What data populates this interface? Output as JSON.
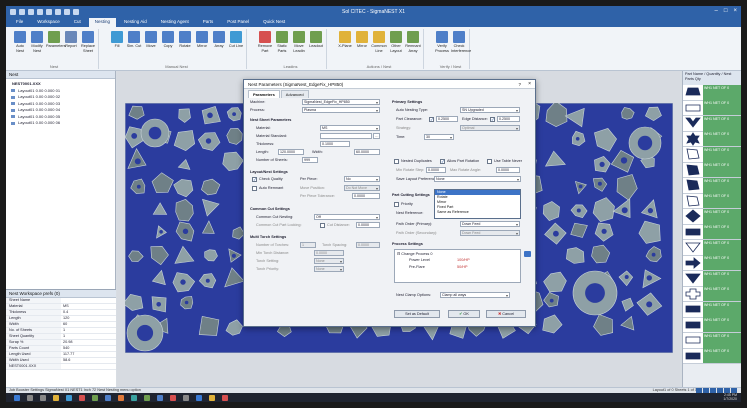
{
  "window": {
    "title": "Sol CITEC - SigmaNEST X1",
    "min_glyph": "–",
    "max_glyph": "□",
    "close_glyph": "×"
  },
  "ribbon": {
    "tabs": [
      "File",
      "Workspace",
      "Cut",
      "Nesting",
      "Nesting Aid",
      "Nesting Agent",
      "Parts",
      "Post Panel",
      "Quick Nest"
    ],
    "active_tab": 3,
    "buttons": [
      {
        "label": "Auto Nest",
        "color": "#4f7fc8"
      },
      {
        "label": "Modify Nest",
        "color": "#4f7fc8"
      },
      {
        "label": "Parameters",
        "color": "#6f9e4f"
      },
      {
        "label": "Report",
        "color": "#6a88b9"
      },
      {
        "label": "Replace Sheet",
        "color": "#4f7fc8"
      },
      {
        "label": "Fill",
        "color": "#3f9ad4"
      },
      {
        "label": "Sim. Cut",
        "color": "#4f7fc8"
      },
      {
        "label": "Move",
        "color": "#4f7fc8"
      },
      {
        "label": "Copy",
        "color": "#4f7fc8"
      },
      {
        "label": "Rotate",
        "color": "#4f7fc8"
      },
      {
        "label": "Mirror",
        "color": "#4f7fc8"
      },
      {
        "label": "Array",
        "color": "#4f7fc8"
      },
      {
        "label": "Cut Line",
        "color": "#3f9ad4"
      },
      {
        "label": "Remove Part",
        "color": "#d65050"
      },
      {
        "label": "Static Parts",
        "color": "#6f9e4f"
      },
      {
        "label": "Move Leadin",
        "color": "#6f9e4f"
      },
      {
        "label": "Leadout",
        "color": "#6f9e4f"
      },
      {
        "label": "X-Plane",
        "color": "#e0b23a"
      },
      {
        "label": "Mirror",
        "color": "#e0b23a"
      },
      {
        "label": "Common Line",
        "color": "#e0b23a"
      },
      {
        "label": "Other Layout",
        "color": "#6f9e4f"
      },
      {
        "label": "Remnant Array",
        "color": "#6f9e4f"
      },
      {
        "label": "Verify Process",
        "color": "#4f7fc8"
      },
      {
        "label": "Check Interference",
        "color": "#4f7fc8"
      }
    ],
    "groups": [
      "Nest",
      "Manual Nest",
      "Leadins",
      "Actions / Nest",
      "Verify / Nest"
    ]
  },
  "left_panel": {
    "title": "Nest",
    "tree": [
      {
        "label": "NEST0001.XXX",
        "root": true
      },
      {
        "label": "Layout01 0.00 0.000 01"
      },
      {
        "label": "Layout01 0.00 0.000 02"
      },
      {
        "label": "Layout01 0.00 0.000 03"
      },
      {
        "label": "Layout01 0.00 0.000 04"
      },
      {
        "label": "Layout01 0.00 0.000 05"
      },
      {
        "label": "Layout01 0.00 0.000 06"
      }
    ],
    "props_title": "Nest Workspace prefs (0)",
    "props": [
      {
        "k": "Sheet Name",
        "v": ""
      },
      {
        "k": "Material",
        "v": "MS"
      },
      {
        "k": "Thickness",
        "v": "0.4"
      },
      {
        "k": "Length",
        "v": "120"
      },
      {
        "k": "Width",
        "v": "60"
      },
      {
        "k": "No. of Sheets",
        "v": "1"
      },
      {
        "k": "Sheet Quantity",
        "v": "1"
      },
      {
        "k": "Scrap %",
        "v": "20.98"
      },
      {
        "k": "Parts Count",
        "v": "540"
      },
      {
        "k": "Length Used",
        "v": "117.77"
      },
      {
        "k": "Width Used",
        "v": "58.6"
      },
      {
        "k": "NEST0001.XXX",
        "v": ""
      }
    ]
  },
  "right_panel": {
    "header": "Part Name / Quantity / Nest Parts Qty",
    "parts": [
      {
        "label": "WH1 NET OF 0",
        "shape": "trap"
      },
      {
        "label": "WH1 NET OF 0",
        "shape": "rect"
      },
      {
        "label": "WH1 NET OF 0",
        "shape": "vee"
      },
      {
        "label": "WH1 NET OF 0",
        "shape": "gear"
      },
      {
        "label": "WH1 NET OF 0",
        "shape": "poly"
      },
      {
        "label": "WH1 NET OF 0",
        "shape": "poly"
      },
      {
        "label": "WH1 NET OF 0",
        "shape": "poly"
      },
      {
        "label": "WH1 NET OF 0",
        "shape": "poly"
      },
      {
        "label": "WH1 NET OF 0",
        "shape": "diamond"
      },
      {
        "label": "WH1 NET OF 0",
        "shape": "rect"
      },
      {
        "label": "WH1 NET OF 0",
        "shape": "tri"
      },
      {
        "label": "WH1 NET OF 0",
        "shape": "arrow"
      },
      {
        "label": "WH1 NET OF 0",
        "shape": "tri"
      },
      {
        "label": "WH1 NET OF 0",
        "shape": "plus"
      },
      {
        "label": "WH1 NET OF 0",
        "shape": "rect"
      },
      {
        "label": "WH1 NET OF 0",
        "shape": "rect"
      },
      {
        "label": "WH1 NET OF 0",
        "shape": "rect"
      },
      {
        "label": "WH1 NET OF 0",
        "shape": "rect"
      }
    ]
  },
  "status": {
    "text": "Job Booster Settings    SigmaNest X1 NEST1    Inch    72    Nest Nesting menu option",
    "right_text": "Layout1 of 0 Sheets 1 of 1"
  },
  "clock": {
    "time": "2:45 PM",
    "date": "1/7/2020"
  },
  "dialog": {
    "title": "Nest Parameters (SigmaNest_EdgeFix_HP850)",
    "help": "?",
    "close": "×",
    "tabs": [
      "Parameters",
      "Advanced"
    ],
    "machine_label": "Machine:",
    "machine_value": "SigmaNest_EdgeFix_HP850",
    "process_label": "Process:",
    "process_value": "Plasma",
    "sheet_section": "Nest Sheet Parameters",
    "material_label": "Material:",
    "material_value": "MS",
    "material_std_label": "Material Standard:",
    "thickness_label": "Thickness:",
    "thickness_value": "0.1000",
    "length_label": "Length:",
    "length_value": "120.0000",
    "width_label": "Width:",
    "width_value": "60.0000",
    "numsheets_label": "Number of Sheets:",
    "numsheets_value": "999",
    "layout_section": "Layout/Nest Settings",
    "check_remnant": "Check Quality",
    "per_piece_label": "Per Piece:",
    "per_piece_value": "No",
    "auto_remnant": "Auto Remnant",
    "move_position": "Move Position:",
    "move_value": "Do Not Move",
    "rem_tol_label": "Per Piece Tolerance:",
    "rem_tol_value": "0.0000",
    "common_section": "Common Cut Settings",
    "common_label": "Common Cut Nesting:",
    "common_value": "Off",
    "common_dist_label": "Common Cut Part Locking:",
    "common_dist_value": "0.0000",
    "common_dist2_label": "Cut Distance:",
    "multi_section": "Multi Torch Settings",
    "mt1": "Number of Torches:",
    "mt1v": "1",
    "mt1b": "Torch Spacing:",
    "mt1bv": "0.0000",
    "mt2": "Min Torch Distance:",
    "mt2v": "0.0000",
    "mt3": "Torch Setting:",
    "mt3v": "None",
    "mt4": "Torch Priority:",
    "mt4v": "None",
    "primary_section": "Primary Settings",
    "autonest_label": "Auto Nesting Type:",
    "autonest_value": "SN Upgraded",
    "partclear_label": "Part Clearance:",
    "partclear_value": "0.2500",
    "edgedist_label": "Edge Distance:",
    "edgedist_value": "0.2500",
    "strategy_label": "Strategy:",
    "strategy_value": "Optimal",
    "time_label": "Time:",
    "time_value": "30",
    "mirror_label": "Nested Duplicates",
    "allow_rotate": "Allow Part Rotation",
    "use_table": "Use Table Never",
    "min_step_label": "Min Rotate Step:",
    "min_step_value": "0.0000",
    "max_step_label": "Max Rotate Angle:",
    "max_step_value": "0.0000",
    "save_layout_label": "Save Layout Preference:",
    "save_layout_value": "None",
    "dropdown_options": [
      "None",
      "Rotate",
      "Mirror",
      "Fixed Part",
      "Same as Reference"
    ],
    "dropdown_selected": 0,
    "part_cut_section": "Part Cutting Settings",
    "priority_label": "Priority",
    "priority_value": "Off",
    "nest_ref_label": "Nest Reference:",
    "path_order_label": "Path Order (Primary):",
    "path_order_value": "Down Feed",
    "path_order2_label": "Path Order (Secondary):",
    "path_order2_value": "Down Feed",
    "process_section": "Process Settings",
    "process_tree_root": "Change Process 0",
    "process_rows": [
      {
        "k": "Power Level",
        "v": "100/HP"
      },
      {
        "k": "Pre-Flare",
        "v": "50/HP"
      }
    ],
    "next_clamp_label": "Nest Clamp Options:",
    "next_clamp_value": "Clamp all ways",
    "btn_default": "Set as Default",
    "btn_ok": "OK",
    "btn_cancel": "Cancel"
  },
  "colors": {
    "sheet_bg": "#2b3c9e",
    "part_fill": "#8ea0a6",
    "part_fill_dark": "#6f8087",
    "ribbon_blue": "#2f62a8",
    "part_label_green": "#5ca96a"
  }
}
